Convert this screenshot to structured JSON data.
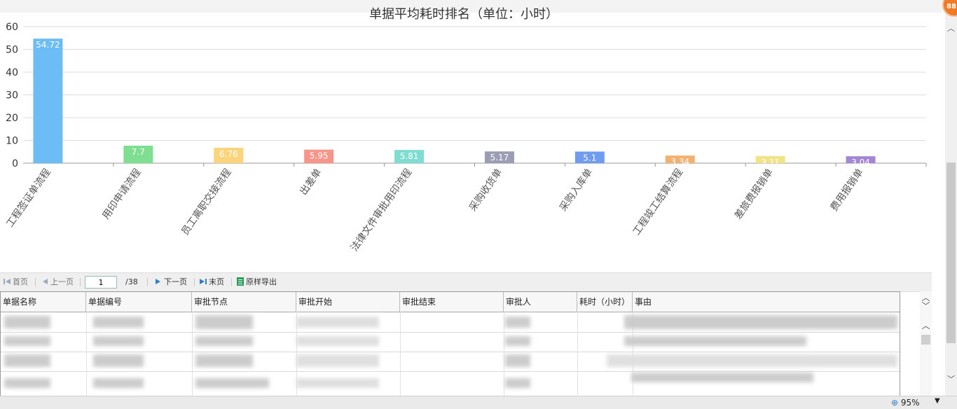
{
  "chart_data": {
    "type": "bar",
    "title": "单据平均耗时排名（单位：小时）",
    "categories": [
      "工程签证单流程",
      "用印申请流程",
      "员工离职交接流程",
      "出差单",
      "法律文件审批用印流程",
      "采购收货单",
      "采购入库单",
      "工程竣工结算流程",
      "差旅费报销单",
      "费用报销单"
    ],
    "values": [
      54.72,
      7.7,
      6.76,
      5.95,
      5.81,
      5.17,
      5.1,
      3.34,
      3.11,
      3.04
    ],
    "value_labels": [
      "54.72",
      "7.7",
      "6.76",
      "5.95",
      "5.81",
      "5.17",
      "5.1",
      "3.34",
      "3.11",
      "3.04"
    ],
    "colors": [
      "#6cbdf5",
      "#7fdf91",
      "#fbd47c",
      "#f7958b",
      "#7fdcd1",
      "#9b9db5",
      "#6f9cf0",
      "#f4b06f",
      "#f3e387",
      "#a486d6"
    ],
    "yticks": [
      "0",
      "10",
      "20",
      "30",
      "40",
      "50",
      "60"
    ],
    "ylim": [
      0,
      60
    ],
    "grid": true,
    "legend": "none"
  },
  "pager": {
    "first": "首页",
    "prev": "上一页",
    "page": "1",
    "total": "/38",
    "next": "下一页",
    "last": "末页",
    "export": "原样导出"
  },
  "table": {
    "columns": [
      "单据名称",
      "单据编号",
      "审批节点",
      "审批开始",
      "审批结束",
      "审批人",
      "耗时（小时）",
      "事由"
    ]
  },
  "status": {
    "zoom": "95%",
    "badge": "88"
  }
}
